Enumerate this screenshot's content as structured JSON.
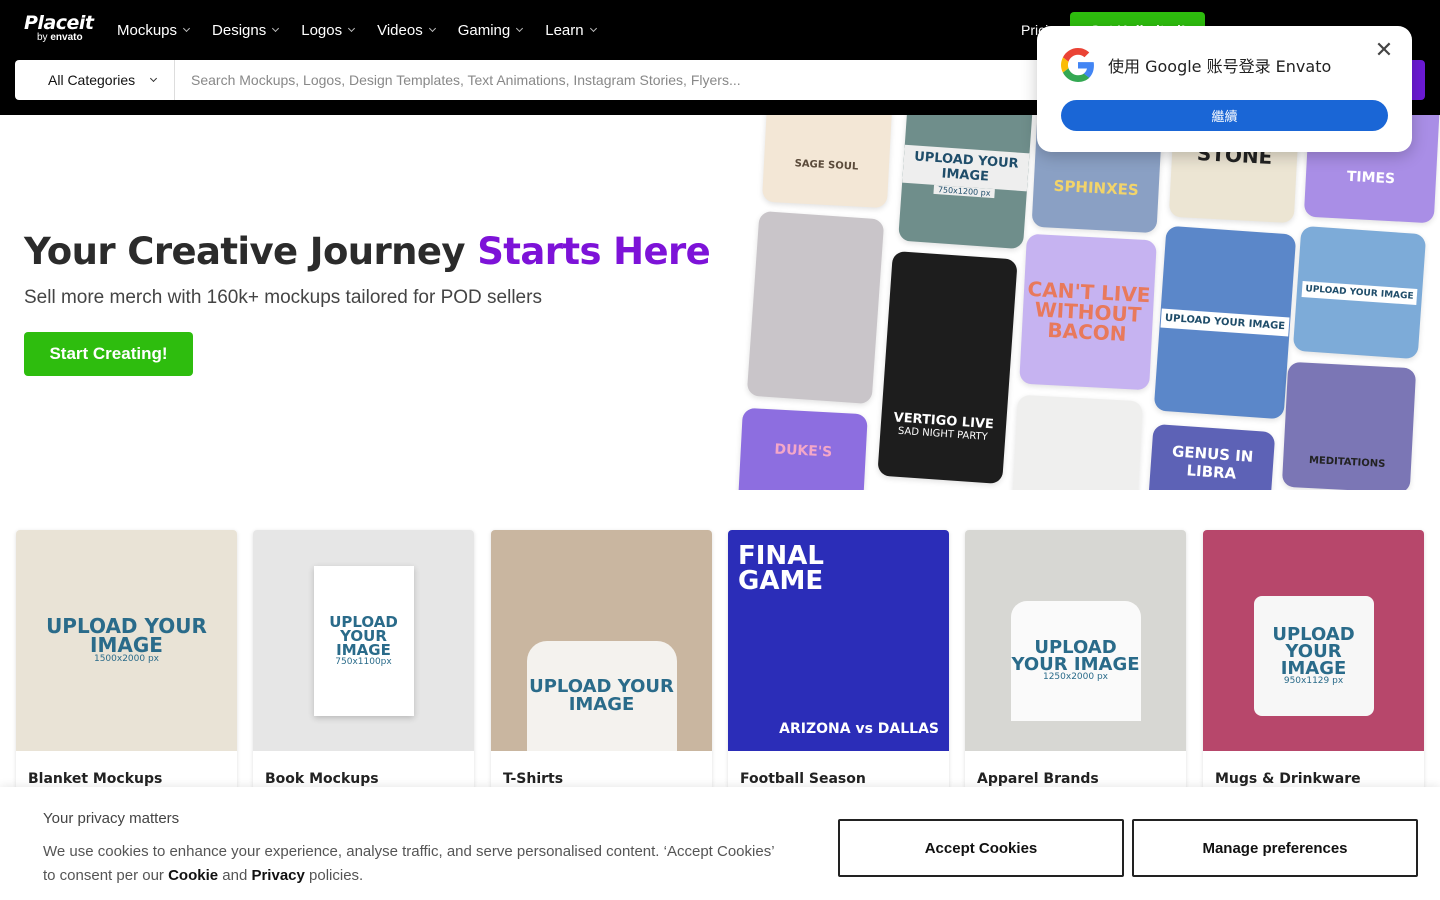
{
  "nav": {
    "logo_main": "Placeit",
    "logo_by": "by",
    "logo_brand": "envato",
    "menu": [
      {
        "label": "Mockups"
      },
      {
        "label": "Designs"
      },
      {
        "label": "Logos"
      },
      {
        "label": "Videos"
      },
      {
        "label": "Gaming"
      },
      {
        "label": "Learn"
      }
    ],
    "pricing": "Prici",
    "cta": "Get Unlimited!"
  },
  "search": {
    "category": "All Categories",
    "placeholder": "Search Mockups, Logos, Design Templates, Text Animations, Instagram Stories, Flyers..."
  },
  "hero": {
    "title_main": "Your Creative Journey ",
    "title_highlight": "Starts Here",
    "subtitle": "Sell more merch with 160k+ mockups tailored for POD sellers",
    "button": "Start Creating!"
  },
  "collage": {
    "tiles": [
      {
        "text": "SAGE SOUL"
      },
      {
        "text": "UPLOAD YOUR IMAGE",
        "size": "750x1200 px"
      },
      {
        "text": "SPHINXES"
      },
      {
        "text": "MAX STONE"
      },
      {
        "text": "TIMES"
      },
      {
        "text": ""
      },
      {
        "text": "VERTIGO LIVE",
        "sub": "SAD NIGHT PARTY"
      },
      {
        "text": "CAN'T LIVE WITHOUT BACON"
      },
      {
        "text": "UPLOAD YOUR IMAGE"
      },
      {
        "text": "UPLOAD YOUR IMAGE"
      },
      {
        "text": "DUKE'S"
      },
      {
        "text": ""
      },
      {
        "text": "GENUS IN LIBRA"
      },
      {
        "text": "MEDITATIONS"
      }
    ]
  },
  "cards": [
    {
      "title": "Blanket Mockups",
      "img_text": "UPLOAD YOUR IMAGE",
      "img_size": "1500x2000 px",
      "color": "#e9e3d6"
    },
    {
      "title": "Book Mockups",
      "img_text": "UPLOAD YOUR IMAGE",
      "img_size": "750x1100px",
      "color": "#e6e6e6"
    },
    {
      "title": "T-Shirts",
      "img_text": "UPLOAD YOUR IMAGE",
      "img_size": "",
      "color": "#c9b6a0"
    },
    {
      "title": "Football Season",
      "img_text": "FINAL GAME",
      "img_size": "ARIZONA vs DALLAS",
      "color": "#2b2db8"
    },
    {
      "title": "Apparel Brands",
      "img_text": "UPLOAD YOUR IMAGE",
      "img_size": "1250x2000 px",
      "color": "#d7d7d3"
    },
    {
      "title": "Mugs & Drinkware",
      "img_text": "UPLOAD YOUR IMAGE",
      "img_size": "950x1129 px",
      "color": "#b7476b"
    }
  ],
  "cookie": {
    "title": "Your privacy matters",
    "text_before": "We use cookies to enhance your experience, analyse traffic, and serve personalised content. ‘Accept Cookies’ to consent per our ",
    "cookie_link": "Cookie",
    "and": " and ",
    "privacy_link": "Privacy",
    "text_after": " policies.",
    "accept": "Accept Cookies",
    "manage": "Manage preferences"
  },
  "google_popup": {
    "title": "使用 Google 账号登录 Envato",
    "button": "繼續",
    "close": "✕"
  },
  "colors": {
    "accent_green": "#2ebd0e",
    "accent_purple": "#7d12d8",
    "google_blue": "#1a66d6"
  }
}
